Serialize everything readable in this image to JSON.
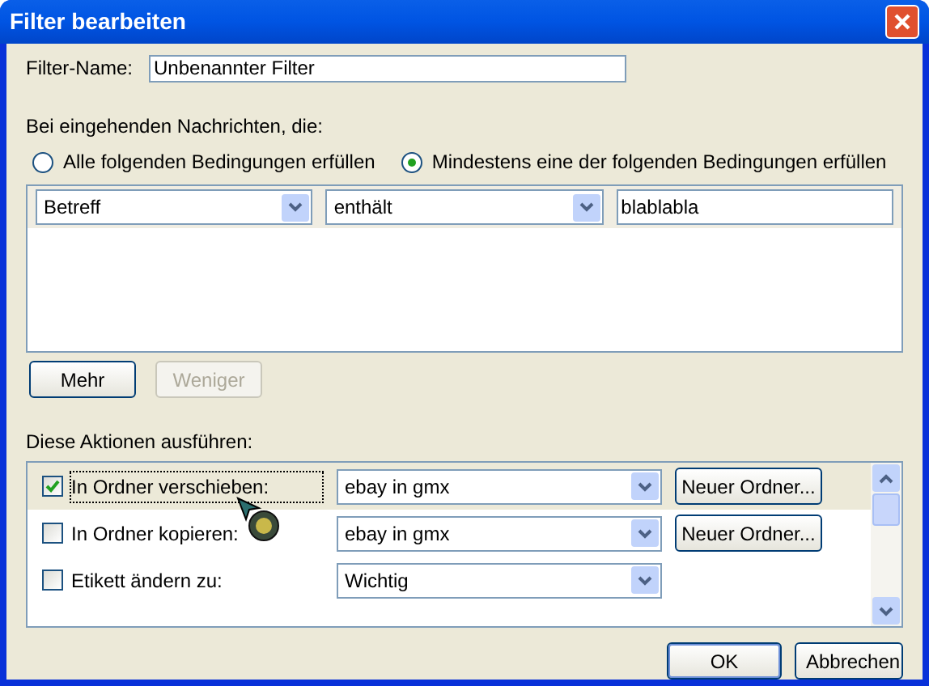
{
  "window": {
    "title": "Filter bearbeiten"
  },
  "filter_name": {
    "label": "Filter-Name:",
    "value": "Unbenannter Filter"
  },
  "match": {
    "label": "Bei eingehenden Nachrichten, die:",
    "options": [
      {
        "label": "Alle folgenden Bedingungen erfüllen",
        "selected": false
      },
      {
        "label": "Mindestens eine der folgenden Bedingungen erfüllen",
        "selected": true
      }
    ]
  },
  "conditions": [
    {
      "field": "Betreff",
      "operator": "enthält",
      "value": "blablabla",
      "selected": true
    }
  ],
  "condition_buttons": [
    {
      "label": "Mehr",
      "disabled": false
    },
    {
      "label": "Weniger",
      "disabled": true
    }
  ],
  "actions_label": "Diese Aktionen ausführen:",
  "actions": [
    {
      "checked": true,
      "selected": true,
      "label": "In Ordner verschieben:",
      "value": "ebay in gmx",
      "button": "Neuer Ordner..."
    },
    {
      "checked": false,
      "selected": false,
      "label": "In Ordner kopieren:",
      "value": "ebay in gmx",
      "button": "Neuer Ordner..."
    },
    {
      "checked": false,
      "selected": false,
      "label": "Etikett ändern zu:",
      "value": "Wichtig"
    }
  ],
  "footer_buttons": [
    {
      "label": "OK",
      "default": true
    },
    {
      "label": "Abbrechen",
      "default": false
    }
  ]
}
